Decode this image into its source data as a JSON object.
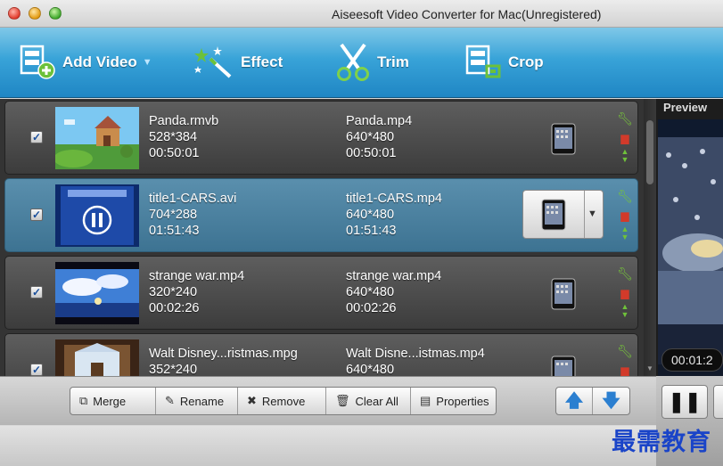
{
  "window": {
    "title": "Aiseesoft Video Converter for Mac(Unregistered)"
  },
  "toolbar": {
    "add_video": "Add Video",
    "effect": "Effect",
    "trim": "Trim",
    "crop": "Crop"
  },
  "files": [
    {
      "src_name": "Panda.rmvb",
      "src_res": "528*384",
      "src_dur": "00:50:01",
      "dst_name": "Panda.mp4",
      "dst_res": "640*480",
      "dst_dur": "00:50:01",
      "checked": true
    },
    {
      "src_name": "title1-CARS.avi",
      "src_res": "704*288",
      "src_dur": "01:51:43",
      "dst_name": "title1-CARS.mp4",
      "dst_res": "640*480",
      "dst_dur": "01:51:43",
      "checked": true
    },
    {
      "src_name": "strange war.mp4",
      "src_res": "320*240",
      "src_dur": "00:02:26",
      "dst_name": "strange war.mp4",
      "dst_res": "640*480",
      "dst_dur": "00:02:26",
      "checked": true
    },
    {
      "src_name": "Walt Disney...ristmas.mpg",
      "src_res": "352*240",
      "src_dur": "",
      "dst_name": "Walt Disne...istmas.mp4",
      "dst_res": "640*480",
      "dst_dur": "",
      "checked": true
    }
  ],
  "actions": {
    "merge": "Merge",
    "rename": "Rename",
    "remove": "Remove",
    "clear_all": "Clear All",
    "properties": "Properties"
  },
  "preview": {
    "label": "Preview",
    "time": "00:01:2"
  },
  "watermark": "最需教育",
  "colors": {
    "toolbar_blue": "#2a95d0",
    "selected_row": "#4a82a2",
    "icon_green": "#76c43a",
    "icon_red": "#d23a2a"
  }
}
